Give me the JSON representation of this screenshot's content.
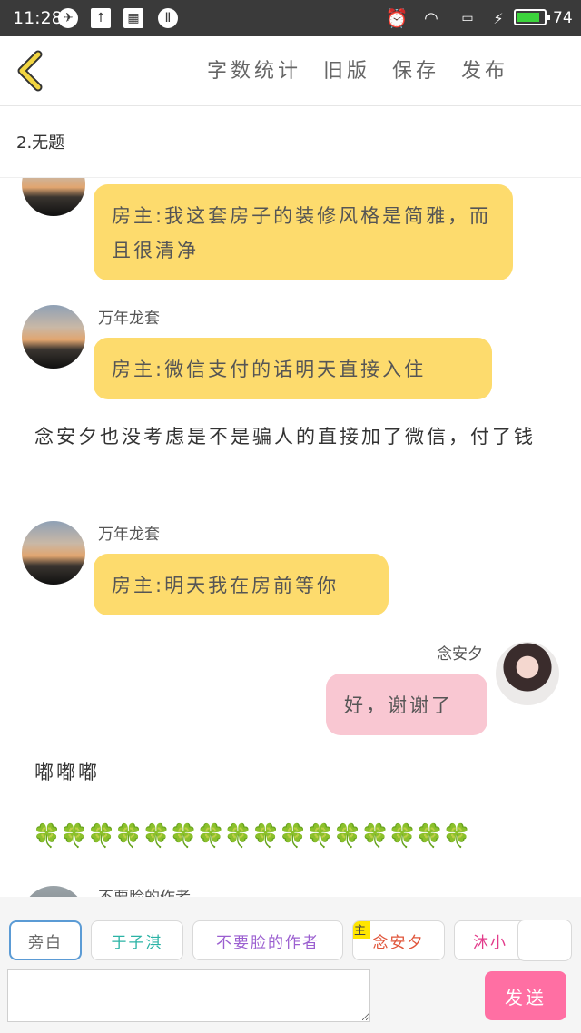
{
  "status_bar": {
    "time": "11:28",
    "battery": "74"
  },
  "header": {
    "back_icon": "chevron-left-icon",
    "actions": [
      "字数统计",
      "旧版",
      "保存",
      "发布"
    ]
  },
  "chapter": {
    "title": "2.无题"
  },
  "chat": {
    "messages": [
      {
        "name": "",
        "text": "房主:我这套房子的装修风格是简雅，而且很清净"
      },
      {
        "name": "万年龙套",
        "text": "房主:微信支付的话明天直接入住"
      },
      {
        "narration": "念安夕也没考虑是不是骗人的直接加了微信，付了钱"
      },
      {
        "name": "万年龙套",
        "text": "房主:明天我在房前等你"
      },
      {
        "name": "念安夕",
        "text": "好，谢谢了"
      },
      {
        "narration": "嘟嘟嘟"
      },
      {
        "narration": "🍀🍀🍀🍀🍀🍀🍀🍀🍀🍀🍀🍀🍀🍀🍀🍀"
      },
      {
        "name": "不要脸的作者",
        "text": ""
      }
    ]
  },
  "bottom": {
    "chips": [
      "旁白",
      "于子淇",
      "不要脸的作者",
      "念安夕",
      "沐小"
    ],
    "host_badge": "主",
    "input_placeholder": "",
    "send_label": "发送"
  },
  "colors": {
    "bubble_other": "#fddb6d",
    "bubble_self": "#f9c7d2",
    "send": "#ff6fa3",
    "accent": "#f2c200"
  }
}
